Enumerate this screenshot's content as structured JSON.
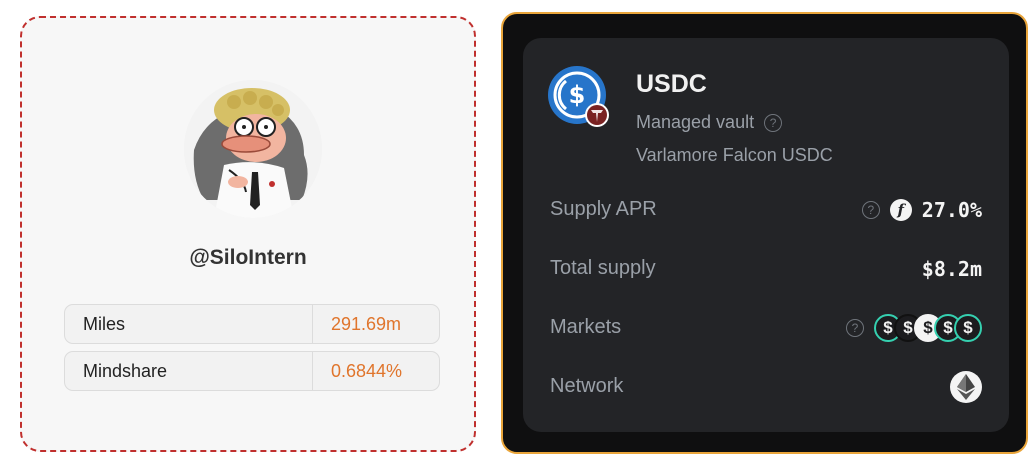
{
  "profile": {
    "username": "@SiloIntern",
    "stats": [
      {
        "label": "Miles",
        "value": "291.69m"
      },
      {
        "label": "Mindshare",
        "value": "0.6844%"
      }
    ]
  },
  "vault": {
    "title": "USDC",
    "type": "Managed vault",
    "name": "Varlamore Falcon USDC",
    "supply_apr": {
      "label": "Supply APR",
      "value": "27.0%"
    },
    "total_supply": {
      "label": "Total supply",
      "value": "$8.2m"
    },
    "markets": {
      "label": "Markets",
      "coins": [
        "$",
        "$",
        "$",
        "$",
        "$"
      ]
    },
    "network": {
      "label": "Network",
      "icon": "ethereum-icon"
    }
  },
  "colors": {
    "accent_orange": "#e0752c",
    "border_red": "#c0302e",
    "vault_border": "#e9a53b",
    "usdc_blue": "#2775ca"
  }
}
